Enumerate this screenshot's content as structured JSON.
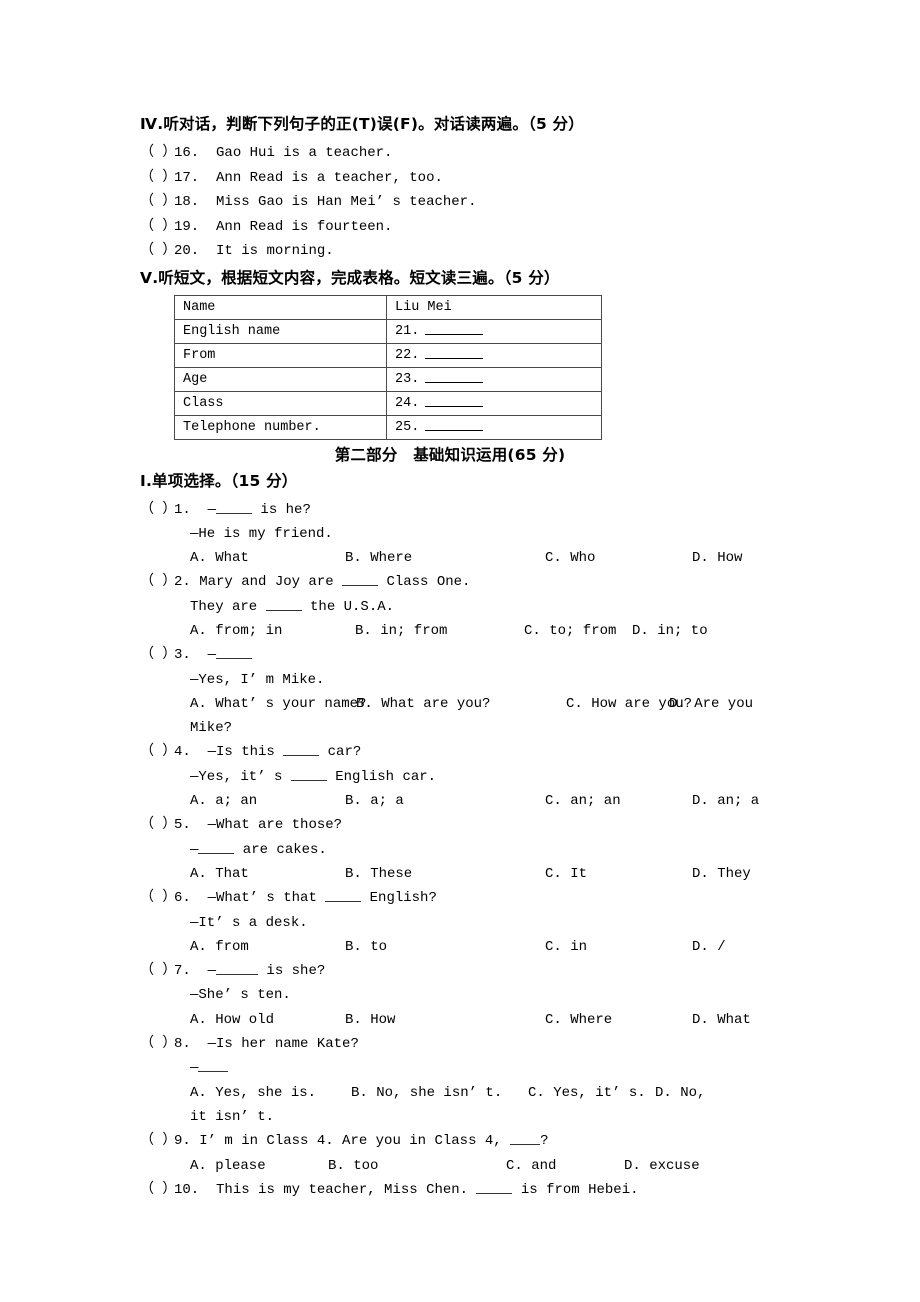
{
  "document": {
    "type": "english-exam-paper"
  },
  "listening_section_4": {
    "heading": "Ⅳ.听对话，判断下列句子的正(T)误(F)。对话读两遍。（5 分）",
    "heading_roman": "Ⅳ",
    "items": [
      {
        "paren": "（   ）",
        "num": "16.",
        "text": "Gao Hui is a teacher."
      },
      {
        "paren": "（   ）",
        "num": "17.",
        "text": "Ann Read is a teacher, too."
      },
      {
        "paren": "（   ）",
        "num": "18.",
        "text": "Miss Gao is Han Mei’ s teacher."
      },
      {
        "paren": "（   ）",
        "num": "19.",
        "text": "Ann Read is fourteen."
      },
      {
        "paren": "（   ）",
        "num": "20.",
        "text": "It is morning."
      }
    ]
  },
  "listening_section_5": {
    "heading": "Ⅴ.听短文，根据短文内容，完成表格。短文读三遍。（5 分）",
    "table": {
      "rows": [
        {
          "key": "Name",
          "value": "Liu Mei",
          "blank": false
        },
        {
          "key": "English name",
          "value": "21.",
          "blank": true
        },
        {
          "key": "From",
          "value": "22.",
          "blank": true
        },
        {
          "key": "Age",
          "value": "23.",
          "blank": true
        },
        {
          "key": "Class",
          "value": "24.",
          "blank": true
        },
        {
          "key": "Telephone number.",
          "value": "25.",
          "blank": true
        }
      ]
    }
  },
  "part_two": {
    "title": "第二部分　基础知识运用(65 分)",
    "section_heading": "Ⅰ.单项选择。（15 分）",
    "questions": [
      {
        "paren": "（   ）",
        "num": "1.",
        "stem_a": "—",
        "stem_b": " is he?",
        "cont": "—He is my friend.",
        "variant": "v1",
        "options": [
          "A. What",
          "B. Where",
          "C. Who",
          "D. How"
        ]
      },
      {
        "paren": "（   ）",
        "num": "2.",
        "stem_a": "Mary and Joy are ",
        "stem_b": " Class One.",
        "cont_a": "They are ",
        "cont_b": " the U.S.A.",
        "variant": "v2",
        "options": [
          "A. from; in",
          "B. in; from",
          "C. to; from",
          "D. in; to"
        ]
      },
      {
        "paren": "（   ）",
        "num": "3.",
        "stem_a": "—",
        "stem_b": "",
        "cont": "—Yes, I’ m Mike.",
        "variant": "v3",
        "options": [
          "A. What’ s your name?",
          "B. What are you?",
          "C. How are you?",
          "D.  Are  you"
        ],
        "wrap": "Mike?"
      },
      {
        "paren": "（   ）",
        "num": "4.",
        "stem_a": "—Is this ",
        "stem_b": " car?",
        "cont_a": "—Yes, it’ s ",
        "cont_b": " English car.",
        "variant": "v1",
        "options": [
          "A. a; an",
          "B. a; a",
          "C. an; an",
          "D. an; a"
        ]
      },
      {
        "paren": "（   ）",
        "num": "5.",
        "stem_a": "—What are those?",
        "stem_b": "",
        "cont_a": "—",
        "cont_b": " are cakes.",
        "variant": "v1",
        "options": [
          "A. That",
          "B. These",
          "C. It",
          "D. They"
        ]
      },
      {
        "paren": "（   ）",
        "num": "6.",
        "stem_a": "—What’ s that ",
        "stem_b": " English?",
        "cont": "—It’ s a desk.",
        "variant": "v1",
        "options": [
          "A. from",
          "B. to",
          "C. in",
          "D. /"
        ]
      },
      {
        "paren": "（   ）",
        "num": "7.",
        "stem_a": "—",
        "stem_b": " is she?",
        "cont": "—She’ s ten.",
        "variant": "v1",
        "options": [
          "A. How old",
          "B. How",
          "C. Where",
          "D. What"
        ]
      },
      {
        "paren": "（   ）",
        "num": "8.",
        "stem_a": "—Is her name Kate?",
        "stem_b": "",
        "cont_a": "—",
        "cont_b": "",
        "variant": "v8",
        "options": [
          "A. Yes, she is.",
          "B. No, she isn’ t.",
          "C. Yes, it’ s.",
          "D.  No,"
        ],
        "wrap": "it isn’ t."
      },
      {
        "paren": "（   ）",
        "num": "9.",
        "stem_a": "I’ m in Class 4. Are you in Class 4, ",
        "stem_b": "?",
        "variant": "v9",
        "options": [
          "A. please",
          "B. too",
          "C. and",
          "D. excuse"
        ]
      },
      {
        "paren": "（   ）",
        "num": "10.",
        "stem_a": "This is my teacher, Miss Chen. ",
        "stem_b": " is from Hebei.",
        "variant": "v1",
        "options": []
      }
    ]
  }
}
